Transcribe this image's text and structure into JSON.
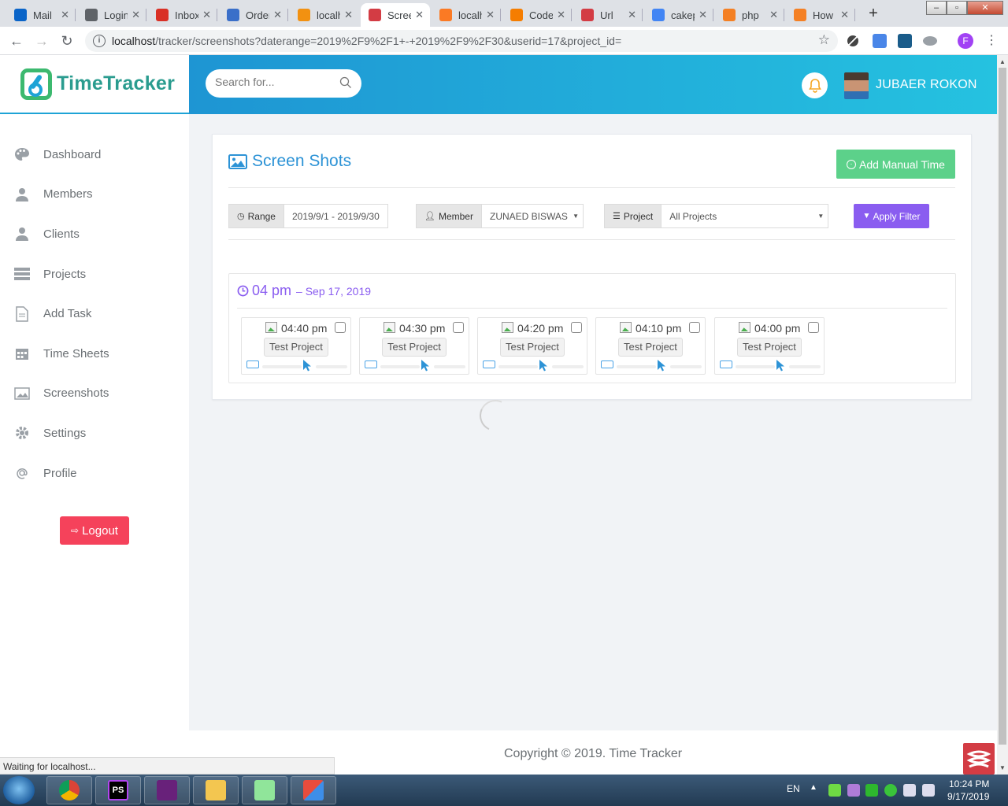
{
  "browser": {
    "tabs": [
      {
        "label": "Mail",
        "icon": "outlook-icon",
        "color": "#0a64c8"
      },
      {
        "label": "Login",
        "icon": "globe-icon",
        "color": "#5f6368"
      },
      {
        "label": "Inbox",
        "icon": "gmail-icon",
        "color": "#d93025"
      },
      {
        "label": "Orders",
        "icon": "order-icon",
        "color": "#3a6fc9"
      },
      {
        "label": "localhost",
        "icon": "phpmyadmin-icon",
        "color": "#f29111"
      },
      {
        "label": "Screenshots",
        "icon": "cakephp-icon",
        "color": "#d33c44"
      },
      {
        "label": "localhost",
        "icon": "xampp-icon",
        "color": "#fb7a24"
      },
      {
        "label": "CodeIgniter",
        "icon": "blogger-icon",
        "color": "#f57d00"
      },
      {
        "label": "Url",
        "icon": "cakephp-icon",
        "color": "#d33c44"
      },
      {
        "label": "cakephp",
        "icon": "google-icon",
        "color": "#4285f4"
      },
      {
        "label": "php",
        "icon": "stackoverflow-icon",
        "color": "#f48024"
      },
      {
        "label": "How",
        "icon": "stackoverflow-icon",
        "color": "#f48024"
      }
    ],
    "url_host": "localhost",
    "url_path": "/tracker/screenshots?daterange=2019%2F9%2F1+-+2019%2F9%2F30&userid=17&project_id=",
    "profile_initial": "F",
    "status_text": "Waiting for localhost..."
  },
  "app": {
    "logo_text": "TimeTracker",
    "search_placeholder": "Search for...",
    "user_name": "JUBAER ROKON",
    "nav": [
      {
        "label": "Dashboard",
        "icon": "palette-icon"
      },
      {
        "label": "Members",
        "icon": "user-icon"
      },
      {
        "label": "Clients",
        "icon": "user-icon"
      },
      {
        "label": "Projects",
        "icon": "tasks-icon"
      },
      {
        "label": "Add Task",
        "icon": "file-icon"
      },
      {
        "label": "Time Sheets",
        "icon": "calendar-icon"
      },
      {
        "label": "Screenshots",
        "icon": "image-icon"
      },
      {
        "label": "Settings",
        "icon": "gear-icon"
      },
      {
        "label": "Profile",
        "icon": "at-icon"
      }
    ],
    "logout_label": "Logout",
    "page_title": "Screen Shots",
    "add_manual_label": "Add Manual Time",
    "filters": {
      "range_label": "Range",
      "range_value": "2019/9/1 - 2019/9/30",
      "member_label": "Member",
      "member_value": "ZUNAED BISWAS",
      "project_label": "Project",
      "project_value": "All Projects",
      "apply_label": "Apply Filter"
    },
    "hour_group": {
      "hour": "04 pm",
      "date": "Sep 17, 2019",
      "shots": [
        {
          "time": "04:40 pm",
          "project": "Test Project"
        },
        {
          "time": "04:30 pm",
          "project": "Test Project"
        },
        {
          "time": "04:20 pm",
          "project": "Test Project"
        },
        {
          "time": "04:10 pm",
          "project": "Test Project"
        },
        {
          "time": "04:00 pm",
          "project": "Test Project"
        }
      ]
    },
    "copyright": "Copyright © 2019. Time Tracker",
    "colors": {
      "accent_blue": "#2d93d6",
      "green": "#5cd18a",
      "purple": "#8a5df0",
      "logout_red": "#f5425b"
    }
  },
  "taskbar": {
    "apps": [
      "chrome",
      "phpstorm",
      "visual-studio",
      "file-explorer",
      "notepad++",
      "other"
    ],
    "language": "EN",
    "time": "10:24 PM",
    "date": "9/17/2019"
  }
}
